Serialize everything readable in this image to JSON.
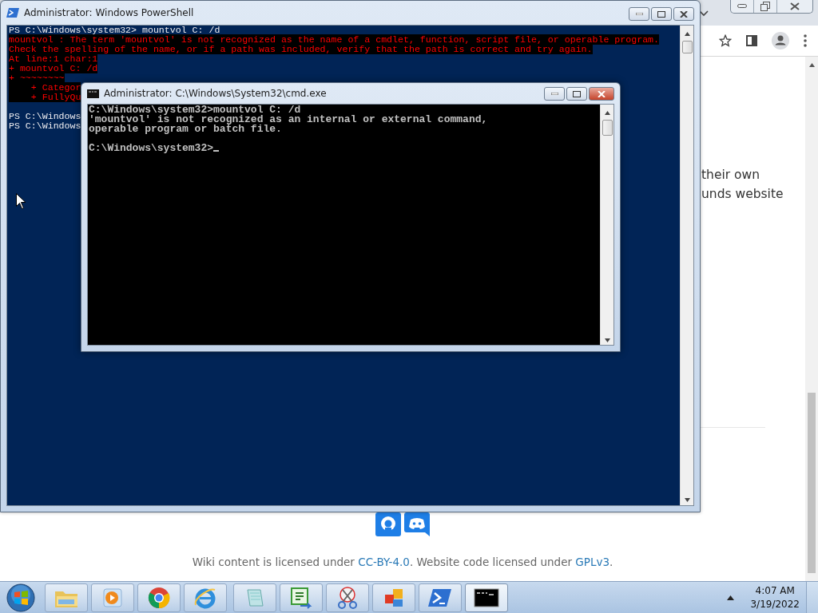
{
  "browser": {
    "paragraph_lines": [
      "their own",
      "unds website"
    ],
    "footer_parts": [
      {
        "text": "Wiki content is licensed under ",
        "link": false
      },
      {
        "text": "CC-BY-4.0",
        "link": true
      },
      {
        "text": ". Website code licensed under ",
        "link": false
      },
      {
        "text": "GPLv3",
        "link": true
      },
      {
        "text": ".",
        "link": false
      }
    ]
  },
  "powershell": {
    "title": "Administrator: Windows PowerShell",
    "active": false,
    "lines": [
      {
        "text": "PS C:\\Windows\\system32> mountvol C: /d",
        "kind": "command"
      },
      {
        "text": "mountvol : The term 'mountvol' is not recognized as the name of a cmdlet, function, script file, or operable program.",
        "kind": "error"
      },
      {
        "text": "Check the spelling of the name, or if a path was included, verify that the path is correct and try again.",
        "kind": "error"
      },
      {
        "text": "At line:1 char:1",
        "kind": "error"
      },
      {
        "text": "+ mountvol C: /d",
        "kind": "error"
      },
      {
        "text": "+ ~~~~~~~~",
        "kind": "error"
      },
      {
        "text": "    + Categor",
        "kind": "error"
      },
      {
        "text": "    + FullyQu",
        "kind": "error"
      },
      {
        "kind": "blank"
      },
      {
        "text": "PS C:\\Windows",
        "kind": "command"
      },
      {
        "text": "PS C:\\Windows",
        "kind": "command"
      }
    ]
  },
  "cmd": {
    "title": "Administrator: C:\\Windows\\System32\\cmd.exe",
    "active": true,
    "lines": [
      {
        "text": "C:\\Windows\\system32>mountvol C: /d",
        "kind": "output"
      },
      {
        "text": "'mountvol' is not recognized as an internal or external command,",
        "kind": "output"
      },
      {
        "text": "operable program or batch file.",
        "kind": "output"
      },
      {
        "kind": "blank"
      },
      {
        "text": "C:\\Windows\\system32>",
        "kind": "prompt"
      }
    ]
  },
  "taskbar": {
    "items": [
      {
        "kind": "folder",
        "selected": false
      },
      {
        "kind": "media",
        "selected": false
      },
      {
        "kind": "chrome",
        "selected": false
      },
      {
        "kind": "ie",
        "selected": false
      },
      {
        "kind": "notepad",
        "selected": false
      },
      {
        "kind": "csharp",
        "selected": false
      },
      {
        "kind": "scissors",
        "selected": false
      },
      {
        "kind": "squares",
        "selected": false
      },
      {
        "kind": "powershell",
        "selected": false
      },
      {
        "kind": "console",
        "selected": true
      }
    ],
    "time": "4:07 AM",
    "date": "3/19/2022"
  }
}
